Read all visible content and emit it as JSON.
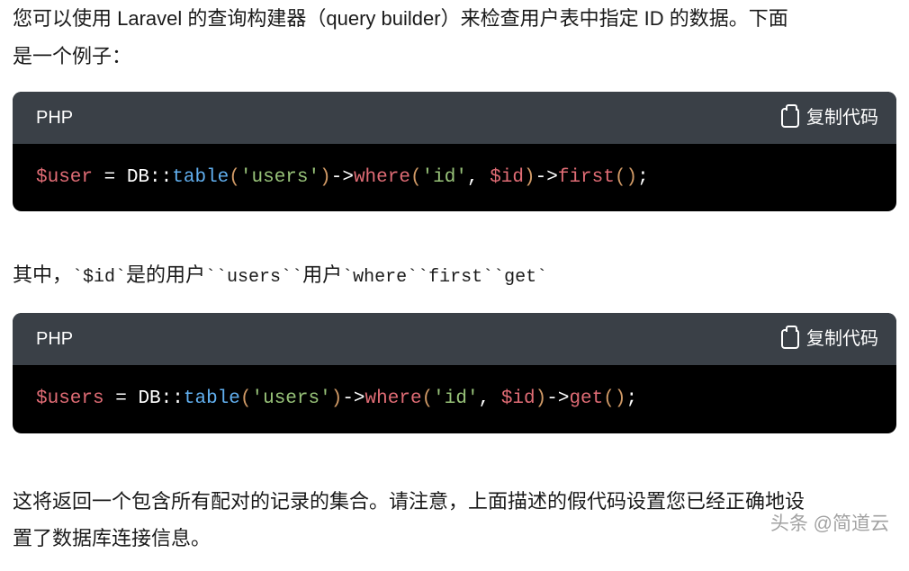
{
  "paragraphs": {
    "intro_line1": "您可以使用 Laravel 的查询构建器（query builder）来检查用户表中指定 ID 的数据。下面",
    "intro_line2": "是一个例子：",
    "middle_prefix": "其中，",
    "middle_seg1": "`$id`",
    "middle_seg2": "是的用户",
    "middle_seg3": "``users``",
    "middle_seg4": "用户",
    "middle_seg5": "`where``first``get`",
    "bottom_line1": "这将返回一个包含所有配对的记录的集合。请注意，上面描述的假代码设置您已经正确地设",
    "bottom_line2": "置了数据库连接信息。"
  },
  "code_blocks": {
    "block1": {
      "lang": "PHP",
      "copy_label": "复制代码",
      "tokens": {
        "var": "$user",
        "eq": " = ",
        "db": "DB",
        "dcolon": "::",
        "table": "table",
        "lp1": "(",
        "str_users": "'users'",
        "rp1": ")",
        "arrow1": "->",
        "where": "where",
        "lp2": "(",
        "str_id": "'id'",
        "comma": ", ",
        "idvar": "$id",
        "rp2": ")",
        "arrow2": "->",
        "first": "first",
        "lp3": "(",
        "rp3": ")",
        "semi": ";"
      }
    },
    "block2": {
      "lang": "PHP",
      "copy_label": "复制代码",
      "tokens": {
        "var": "$users",
        "eq": " = ",
        "db": "DB",
        "dcolon": "::",
        "table": "table",
        "lp1": "(",
        "str_users": "'users'",
        "rp1": ")",
        "arrow1": "->",
        "where": "where",
        "lp2": "(",
        "str_id": "'id'",
        "comma": ", ",
        "idvar": "$id",
        "rp2": ")",
        "arrow2": "->",
        "get": "get",
        "lp3": "(",
        "rp3": ")",
        "semi": ";"
      }
    }
  },
  "watermark": "头条 @简道云"
}
